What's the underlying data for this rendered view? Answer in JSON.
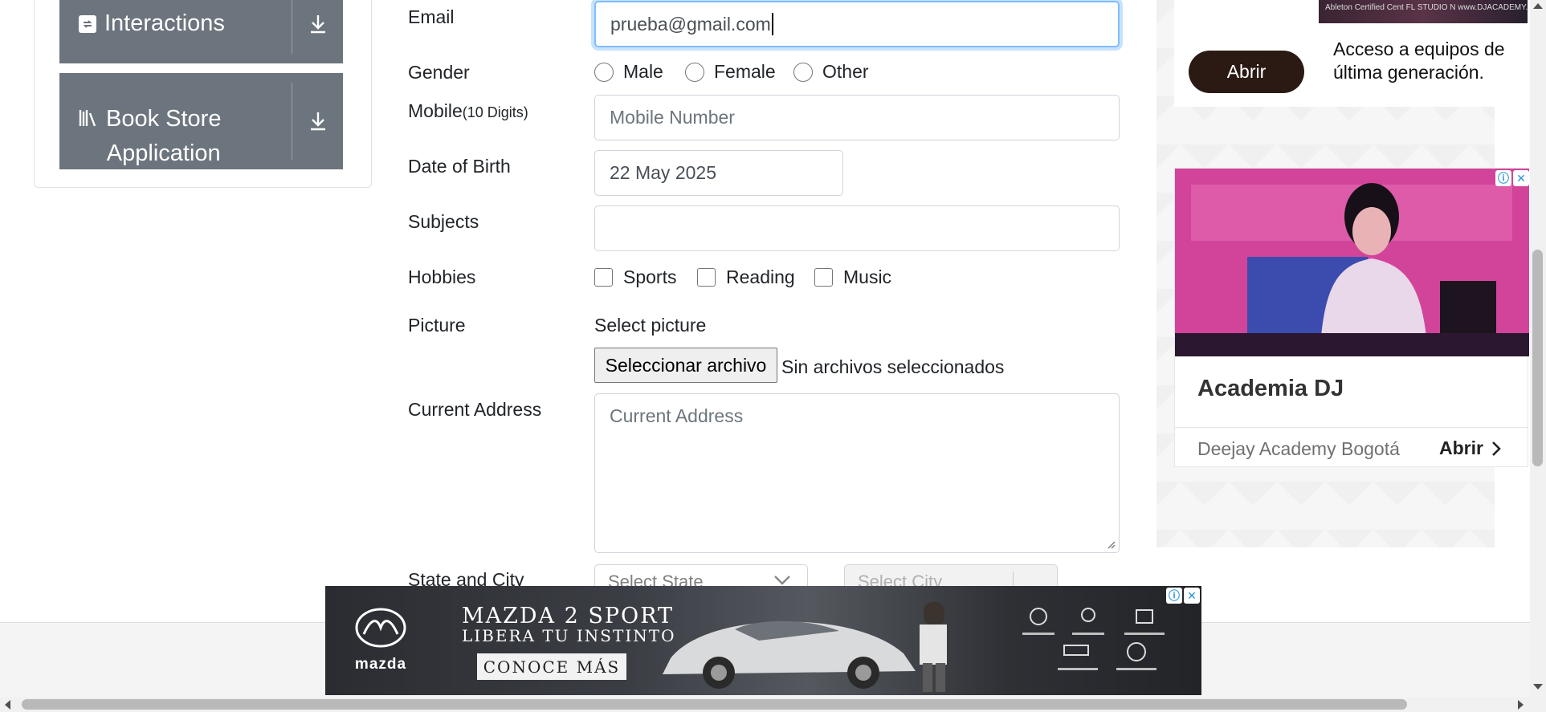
{
  "sidebar": {
    "groups": [
      {
        "label": "Interactions",
        "icon": "interactions-icon"
      },
      {
        "label": "Book Store Application",
        "label_line1": "Book Store",
        "label_line2": "Application",
        "icon": "book-store-icon"
      }
    ]
  },
  "form": {
    "email": {
      "label": "Email",
      "value": "prueba@gmail.com"
    },
    "gender": {
      "label": "Gender",
      "options": [
        "Male",
        "Female",
        "Other"
      ]
    },
    "mobile": {
      "label": "Mobile",
      "hint": "(10 Digits)",
      "placeholder": "Mobile Number"
    },
    "dob": {
      "label": "Date of Birth",
      "value": "22 May 2025"
    },
    "subjects": {
      "label": "Subjects",
      "value": ""
    },
    "hobbies": {
      "label": "Hobbies",
      "options": [
        "Sports",
        "Reading",
        "Music"
      ]
    },
    "picture": {
      "label": "Picture",
      "prompt": "Select picture",
      "button": "Seleccionar archivo",
      "status": "Sin archivos seleccionados"
    },
    "address": {
      "label": "Current Address",
      "placeholder": "Current Address"
    },
    "state_city": {
      "label": "State and City",
      "state_placeholder": "Select State",
      "city_placeholder": "Select City"
    }
  },
  "ad_right": {
    "top_button": "Abrir",
    "top_text": "Acceso a equipos de última generación.",
    "thumb_text": "Ableton Certified Cent  FL STUDIO  N  www.DJACADEMY.EDU.CO",
    "card_title": "Academia DJ",
    "card_subtitle": "Deejay Academy Bogotá",
    "card_button": "Abrir"
  },
  "ad_bottom": {
    "brand": "mazda",
    "title": "MAZDA 2 SPORT",
    "subtitle": "LIBERA TU INSTINTO",
    "cta": "CONOCE MÁS"
  },
  "colors": {
    "sidebar_bg": "#6c757d",
    "focus_border": "#80bdff",
    "ad_button": "#2b1a14"
  }
}
